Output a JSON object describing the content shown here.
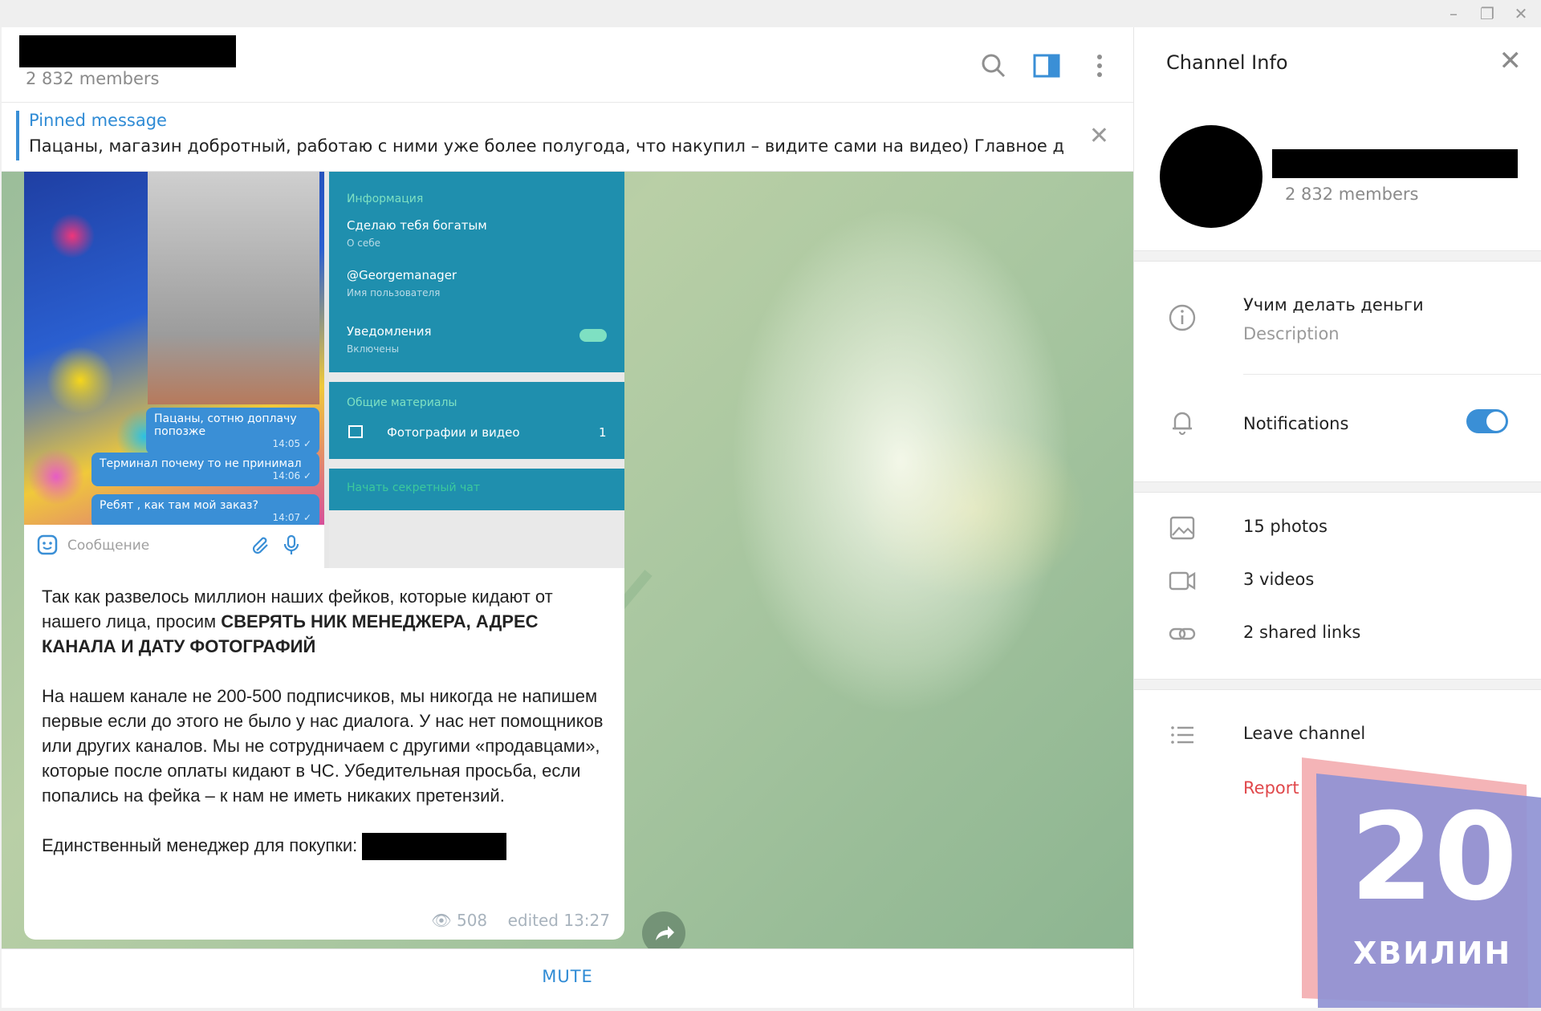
{
  "window": {
    "minimize": "–",
    "maximize": "❐",
    "close": "✕"
  },
  "header": {
    "members": "2 832 members"
  },
  "pinned": {
    "title": "Pinned message",
    "text": "Пацаны, магазин добротный, работаю с ними уже более полугода, что накупил – видите сами на видео) Главное де..."
  },
  "screenshot": {
    "bubble1": "Пацаны, сотню доплачу попозже",
    "bubble1_time": "14:05 ✓",
    "bubble2": "Терминал почему то не принимал",
    "bubble2_time": "14:06 ✓",
    "bubble3": "Ребят , как там мой заказ?",
    "bubble3_time": "14:07 ✓",
    "compose_placeholder": "Сообщение",
    "info_header": "Информация",
    "info_bio": "Сделаю тебя богатым",
    "info_bio_sub": "О себе",
    "info_username": "@Georgemanager",
    "info_username_sub": "Имя пользователя",
    "info_notif": "Уведомления",
    "info_notif_sub": "Включены",
    "shared_header": "Общие материалы",
    "shared_item": "Фотографии и видео",
    "shared_count": "1",
    "secret_chat": "Начать секретный чат"
  },
  "message": {
    "para1_plain": "Так как развелось миллион наших фейков, которые кидают от нашего лица, просим ",
    "para1_bold": "СВЕРЯТЬ НИК МЕНЕДЖЕРА, АДРЕС КАНАЛА И ДАТУ ФОТОГРАФИЙ",
    "para2": "На нашем канале не 200-500 подписчиков, мы никогда не напишем первые если до этого не было у нас диалога. У нас нет помощников или других каналов. Мы не сотрудничаем с другими «продавцами», которые после оплаты кидают в ЧС. Убедительная просьба, если попались на фейка – к нам не иметь никаких претензий.",
    "para3": "Единственный менеджер для покупки: ",
    "views": "508",
    "edited": "edited 13:27"
  },
  "footer": {
    "mute": "MUTE"
  },
  "side": {
    "title": "Channel Info",
    "members": "2 832 members",
    "description": "Учим делать деньги",
    "description_label": "Description",
    "notifications": "Notifications",
    "notifications_on": true,
    "photos": "15 photos",
    "videos": "3 videos",
    "links": "2 shared links",
    "leave": "Leave channel",
    "report": "Report"
  },
  "watermark": {
    "number": "20",
    "word": "ХВИЛИН"
  },
  "colors": {
    "accent": "#3a8fd6",
    "report": "#e0484b",
    "tg_teal": "#1f8fae"
  }
}
